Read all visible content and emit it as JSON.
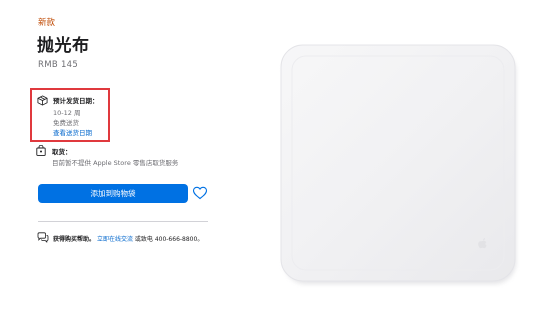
{
  "product": {
    "badge": "新款",
    "name": "抛光布",
    "price": "RMB 145"
  },
  "delivery": {
    "label": "预计发货日期：",
    "date": "10-12 周",
    "shipping": "免费送货",
    "link": "查看送货日期"
  },
  "pickup": {
    "label": "取货：",
    "status": "目前暂不提供 Apple Store 零售店取货服务"
  },
  "actions": {
    "add_to_bag": "添加到购物袋"
  },
  "help": {
    "prefix": "获得购买帮助。",
    "link": "立即在线交流",
    "middle": "或致电",
    "phone": "400-666-8800。"
  },
  "colors": {
    "accent_blue": "#0071e3",
    "link_blue": "#0066cc",
    "badge_orange": "#bf4800",
    "highlight_red": "#e0393e"
  },
  "icons": [
    "box-icon",
    "store-bag-icon",
    "heart-icon",
    "chat-icon",
    "apple-logo-icon"
  ]
}
